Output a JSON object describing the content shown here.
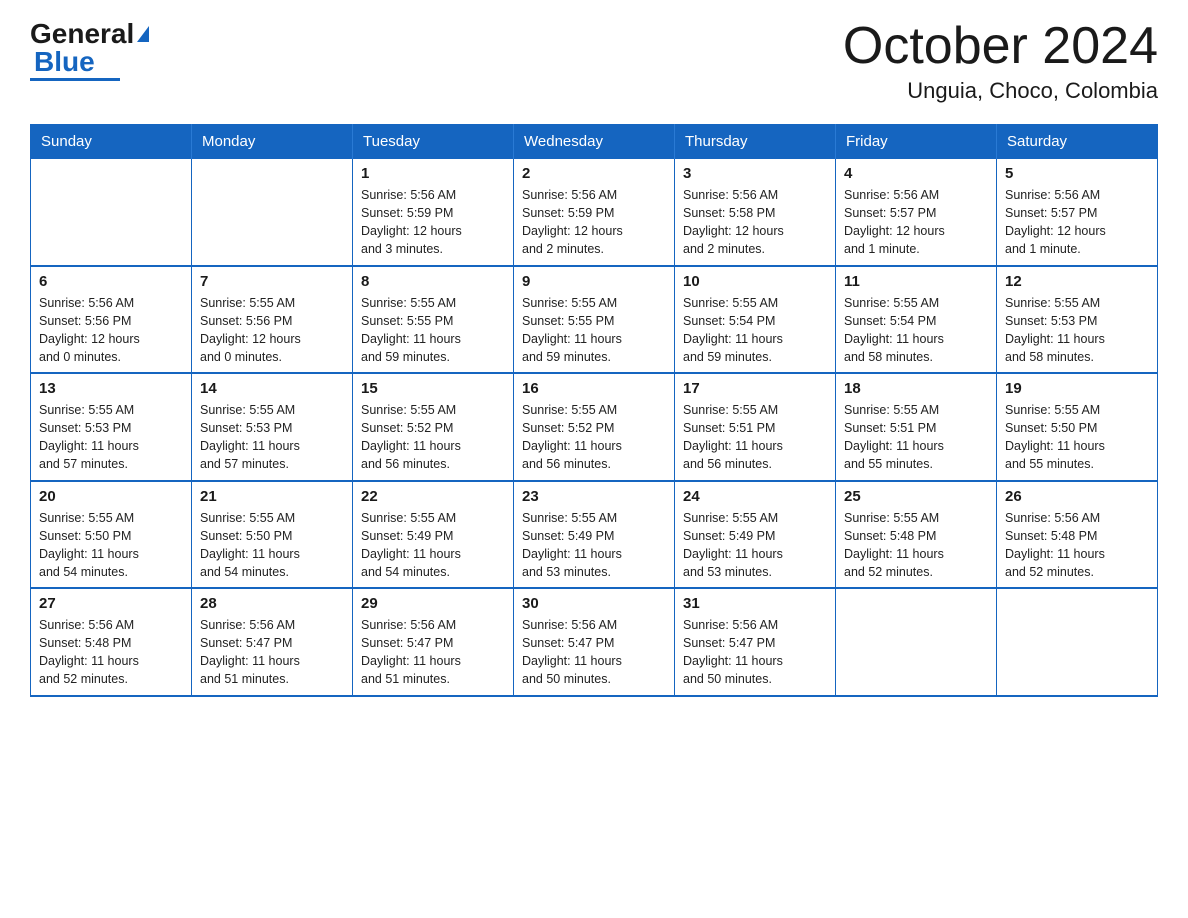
{
  "logo": {
    "general": "General",
    "blue": "Blue"
  },
  "header": {
    "month": "October 2024",
    "location": "Unguia, Choco, Colombia"
  },
  "days_of_week": [
    "Sunday",
    "Monday",
    "Tuesday",
    "Wednesday",
    "Thursday",
    "Friday",
    "Saturday"
  ],
  "weeks": [
    [
      {
        "day": "",
        "info": ""
      },
      {
        "day": "",
        "info": ""
      },
      {
        "day": "1",
        "info": "Sunrise: 5:56 AM\nSunset: 5:59 PM\nDaylight: 12 hours\nand 3 minutes."
      },
      {
        "day": "2",
        "info": "Sunrise: 5:56 AM\nSunset: 5:59 PM\nDaylight: 12 hours\nand 2 minutes."
      },
      {
        "day": "3",
        "info": "Sunrise: 5:56 AM\nSunset: 5:58 PM\nDaylight: 12 hours\nand 2 minutes."
      },
      {
        "day": "4",
        "info": "Sunrise: 5:56 AM\nSunset: 5:57 PM\nDaylight: 12 hours\nand 1 minute."
      },
      {
        "day": "5",
        "info": "Sunrise: 5:56 AM\nSunset: 5:57 PM\nDaylight: 12 hours\nand 1 minute."
      }
    ],
    [
      {
        "day": "6",
        "info": "Sunrise: 5:56 AM\nSunset: 5:56 PM\nDaylight: 12 hours\nand 0 minutes."
      },
      {
        "day": "7",
        "info": "Sunrise: 5:55 AM\nSunset: 5:56 PM\nDaylight: 12 hours\nand 0 minutes."
      },
      {
        "day": "8",
        "info": "Sunrise: 5:55 AM\nSunset: 5:55 PM\nDaylight: 11 hours\nand 59 minutes."
      },
      {
        "day": "9",
        "info": "Sunrise: 5:55 AM\nSunset: 5:55 PM\nDaylight: 11 hours\nand 59 minutes."
      },
      {
        "day": "10",
        "info": "Sunrise: 5:55 AM\nSunset: 5:54 PM\nDaylight: 11 hours\nand 59 minutes."
      },
      {
        "day": "11",
        "info": "Sunrise: 5:55 AM\nSunset: 5:54 PM\nDaylight: 11 hours\nand 58 minutes."
      },
      {
        "day": "12",
        "info": "Sunrise: 5:55 AM\nSunset: 5:53 PM\nDaylight: 11 hours\nand 58 minutes."
      }
    ],
    [
      {
        "day": "13",
        "info": "Sunrise: 5:55 AM\nSunset: 5:53 PM\nDaylight: 11 hours\nand 57 minutes."
      },
      {
        "day": "14",
        "info": "Sunrise: 5:55 AM\nSunset: 5:53 PM\nDaylight: 11 hours\nand 57 minutes."
      },
      {
        "day": "15",
        "info": "Sunrise: 5:55 AM\nSunset: 5:52 PM\nDaylight: 11 hours\nand 56 minutes."
      },
      {
        "day": "16",
        "info": "Sunrise: 5:55 AM\nSunset: 5:52 PM\nDaylight: 11 hours\nand 56 minutes."
      },
      {
        "day": "17",
        "info": "Sunrise: 5:55 AM\nSunset: 5:51 PM\nDaylight: 11 hours\nand 56 minutes."
      },
      {
        "day": "18",
        "info": "Sunrise: 5:55 AM\nSunset: 5:51 PM\nDaylight: 11 hours\nand 55 minutes."
      },
      {
        "day": "19",
        "info": "Sunrise: 5:55 AM\nSunset: 5:50 PM\nDaylight: 11 hours\nand 55 minutes."
      }
    ],
    [
      {
        "day": "20",
        "info": "Sunrise: 5:55 AM\nSunset: 5:50 PM\nDaylight: 11 hours\nand 54 minutes."
      },
      {
        "day": "21",
        "info": "Sunrise: 5:55 AM\nSunset: 5:50 PM\nDaylight: 11 hours\nand 54 minutes."
      },
      {
        "day": "22",
        "info": "Sunrise: 5:55 AM\nSunset: 5:49 PM\nDaylight: 11 hours\nand 54 minutes."
      },
      {
        "day": "23",
        "info": "Sunrise: 5:55 AM\nSunset: 5:49 PM\nDaylight: 11 hours\nand 53 minutes."
      },
      {
        "day": "24",
        "info": "Sunrise: 5:55 AM\nSunset: 5:49 PM\nDaylight: 11 hours\nand 53 minutes."
      },
      {
        "day": "25",
        "info": "Sunrise: 5:55 AM\nSunset: 5:48 PM\nDaylight: 11 hours\nand 52 minutes."
      },
      {
        "day": "26",
        "info": "Sunrise: 5:56 AM\nSunset: 5:48 PM\nDaylight: 11 hours\nand 52 minutes."
      }
    ],
    [
      {
        "day": "27",
        "info": "Sunrise: 5:56 AM\nSunset: 5:48 PM\nDaylight: 11 hours\nand 52 minutes."
      },
      {
        "day": "28",
        "info": "Sunrise: 5:56 AM\nSunset: 5:47 PM\nDaylight: 11 hours\nand 51 minutes."
      },
      {
        "day": "29",
        "info": "Sunrise: 5:56 AM\nSunset: 5:47 PM\nDaylight: 11 hours\nand 51 minutes."
      },
      {
        "day": "30",
        "info": "Sunrise: 5:56 AM\nSunset: 5:47 PM\nDaylight: 11 hours\nand 50 minutes."
      },
      {
        "day": "31",
        "info": "Sunrise: 5:56 AM\nSunset: 5:47 PM\nDaylight: 11 hours\nand 50 minutes."
      },
      {
        "day": "",
        "info": ""
      },
      {
        "day": "",
        "info": ""
      }
    ]
  ]
}
